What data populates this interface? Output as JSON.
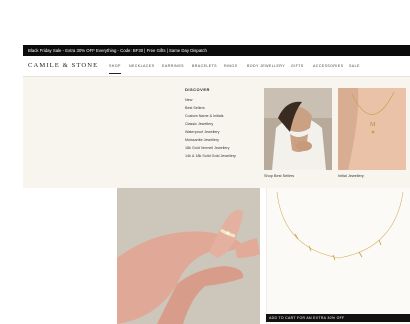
{
  "announcement": "Black Friday Sale - Extra 30% OFF Everything - Code: BF30 | Free Gifts | Same Day Dispatch",
  "logo": "CAMILE & STONE",
  "nav": [
    "SHOP",
    "NECKLACES",
    "EARRINGS",
    "BRACELETS",
    "RINGS",
    "BODY JEWELLERY",
    "GIFTS",
    "ACCESSORIES",
    "SALE"
  ],
  "discover": {
    "title": "DISCOVER",
    "links": [
      "New",
      "Best Sellers",
      "Custom Name & Initials",
      "Classic Jewellery",
      "Waterproof Jewellery",
      "Moissanite Jewellery",
      "18k Gold Vermeil Jewellery",
      "14k & 18k Solid Gold Jewellery"
    ]
  },
  "promos": [
    {
      "label": "Shop Best Sellers"
    },
    {
      "label": "Initial Jewellery"
    }
  ],
  "cart_bar": "ADD TO CART FOR AN EXTRA 30% OFF"
}
